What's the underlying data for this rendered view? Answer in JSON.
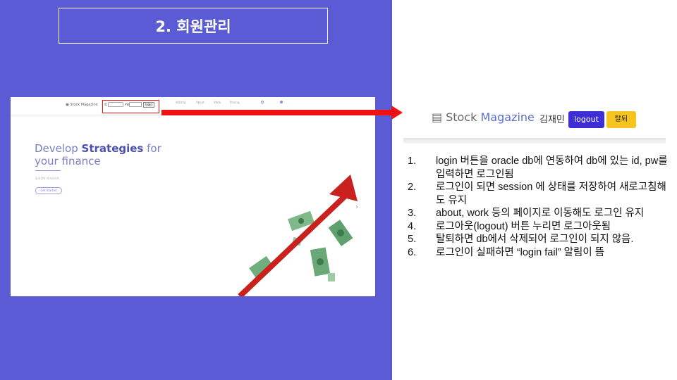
{
  "slide": {
    "title": "2. 회원관리",
    "background_color": "#5b5bd6"
  },
  "screenshot": {
    "logo_text": "Stock Magazine",
    "id_label": "ID",
    "pw_label": "PW",
    "login_button": "login",
    "nav_items": [
      "회원가입",
      "About",
      "Work",
      "Pricing"
    ],
    "hero_title_prefix": "Develop ",
    "hero_title_bold": "Strategies",
    "hero_title_suffix": " for",
    "hero_title_line2": "your finance",
    "hero_small_text": "투자전략 하이라이트",
    "hero_button": "Get Started",
    "carousel_next_icon": "chevron-right-icon"
  },
  "header_preview": {
    "logo_icon": "building-icon",
    "logo_stock": "Stock",
    "logo_magazine": "Magazine",
    "user_name": "김재민",
    "logout_button": "logout",
    "leave_button": "탈퇴",
    "logout_color": "#3d2ed6",
    "leave_color": "#f7c31e"
  },
  "steps": [
    {
      "num": "1.",
      "text": "login 버튼을 oracle db에 연동하여 db에 있는 id, pw를 입력하면 로그인됨"
    },
    {
      "num": "2.",
      "text": " 로그인이 되면 session 에 상태를 저장하여 새로고침해도 유지"
    },
    {
      "num": "3.",
      "text": "about, work 등의 페이지로 이동해도 로그인 유지"
    },
    {
      "num": "4.",
      "text": "로그아웃(logout) 버튼 누리면 로그아웃됨"
    },
    {
      "num": "5.",
      "text": "탈퇴하면 db에서 삭제되어 로그인이 되지 않음."
    },
    {
      "num": "6.",
      "text": "로그인이 실패하면 “login fail” 알림이 뜸"
    }
  ]
}
